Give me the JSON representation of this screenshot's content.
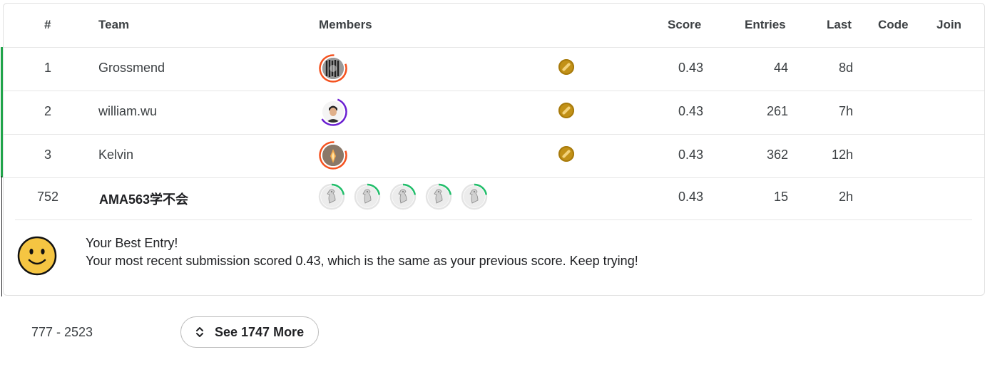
{
  "columns": {
    "rank": "#",
    "team": "Team",
    "members": "Members",
    "score": "Score",
    "entries": "Entries",
    "last": "Last",
    "code": "Code",
    "join": "Join"
  },
  "rows": [
    {
      "rank": "1",
      "team": "Grossmend",
      "score": "0.43",
      "entries": "44",
      "last": "8d",
      "ring_color": "#f4511e",
      "medal": "gold-medal-icon"
    },
    {
      "rank": "2",
      "team": "william.wu",
      "score": "0.43",
      "entries": "261",
      "last": "7h",
      "ring_color": "#6a1fd1",
      "medal": "gold-medal-icon"
    },
    {
      "rank": "3",
      "team": "Kelvin",
      "score": "0.43",
      "entries": "362",
      "last": "12h",
      "ring_color": "#f4511e",
      "medal": "gold-medal-icon"
    }
  ],
  "my_team": {
    "rank": "752",
    "team": "AMA563学不会",
    "score": "0.43",
    "entries": "15",
    "last": "2h",
    "member_count": 5,
    "ring_color": "#20be6a"
  },
  "message": {
    "title": "Your Best Entry!",
    "body": "Your most recent submission scored 0.43, which is the same as your previous score. Keep trying!"
  },
  "footer": {
    "range": "777 - 2523",
    "see_more": "See 1747 More"
  },
  "colors": {
    "accent_green": "#20a44a",
    "medal_gold": "#c29117",
    "smiley": "#f5c542"
  }
}
